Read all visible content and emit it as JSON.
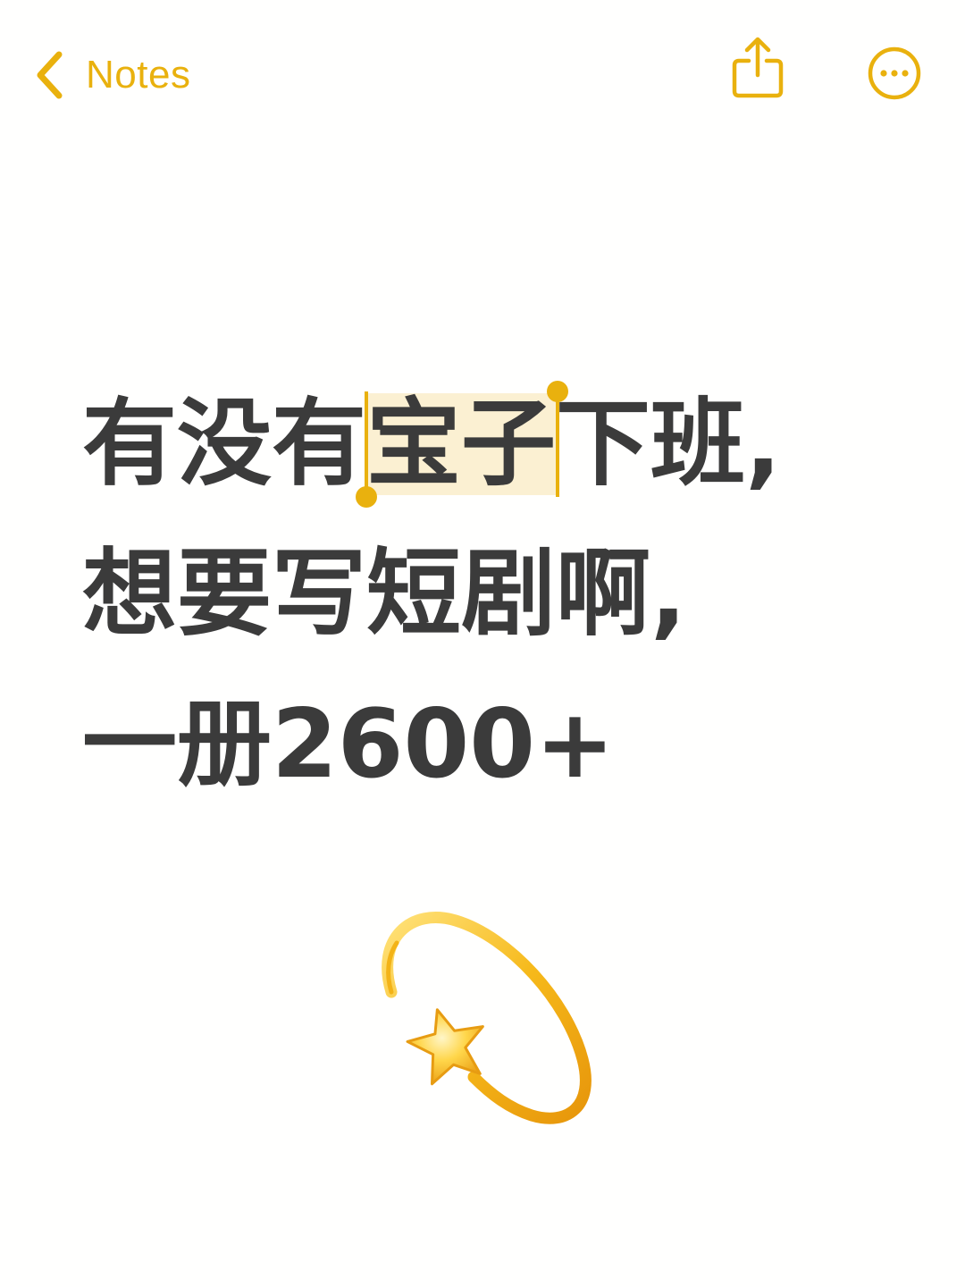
{
  "colors": {
    "accent": "#E9B10E",
    "text": "#3B3B3B",
    "selection_highlight": "#FBF0D2",
    "background": "#FFFFFE"
  },
  "navbar": {
    "back_icon": "chevron-left-icon",
    "back_label": "Notes",
    "share_icon": "share-icon",
    "more_icon": "ellipsis-circle-icon"
  },
  "note": {
    "line1": {
      "before": "有没有",
      "selected": "宝子",
      "after": "下班,"
    },
    "line2": "想要写短剧啊,",
    "line3": "一册2600+"
  },
  "emoji": {
    "icon": "dizzy-star-emoji-icon"
  }
}
